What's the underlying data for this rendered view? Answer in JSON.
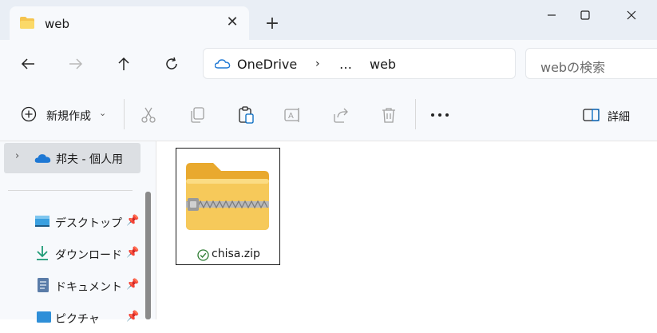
{
  "tab": {
    "title": "web",
    "close_icon": "close-icon",
    "new_tab_icon": "plus-icon"
  },
  "address": {
    "crumbs": [
      "OneDrive",
      "…",
      "web"
    ],
    "search_placeholder": "webの検索"
  },
  "toolbar": {
    "new_label": "新規作成",
    "details_label": "詳細"
  },
  "sidebar": {
    "items": [
      {
        "label": "邦夫 - 個人用",
        "icon": "onedrive-icon"
      },
      {
        "label": "デスクトップ",
        "icon": "desktop-icon"
      },
      {
        "label": "ダウンロード",
        "icon": "download-icon"
      },
      {
        "label": "ドキュメント",
        "icon": "document-icon"
      },
      {
        "label": "ピクチャ",
        "icon": "pictures-icon"
      }
    ]
  },
  "files": [
    {
      "name": "chisa.zip",
      "icon": "zip-folder-icon",
      "status": "synced-check-icon"
    }
  ],
  "colors": {
    "accent": "#0067c0",
    "folder": "#f5c44f",
    "onedrive": "#1e78d4",
    "sync": "#2e7d32"
  }
}
